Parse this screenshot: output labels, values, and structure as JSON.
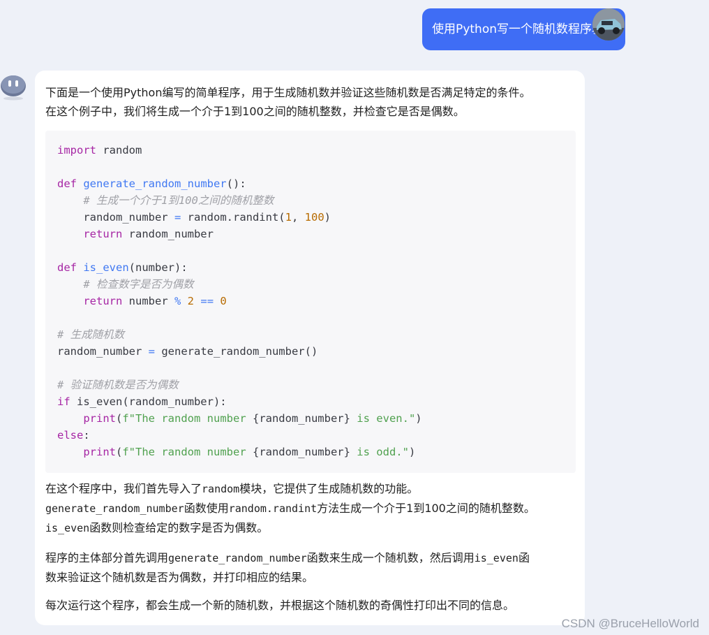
{
  "user_message": "使用Python写一个随机数程序验证",
  "reply": {
    "intro_line1": "下面是一个使用Python编写的简单程序，用于生成随机数并验证这些随机数是否满足特定的条件。",
    "intro_line2": "在这个例子中，我们将生成一个介于1到100之间的随机整数，并检查它是否是偶数。",
    "code": {
      "l1_kw": "import",
      "l1_rest": " random",
      "l3_kw": "def",
      "l3_fn": "generate_random_number",
      "l3_rest": "():",
      "l4_cm": "# 生成一个介于1到100之间的随机整数",
      "l5_a": "random_number ",
      "l5_op": "=",
      "l5_b": " random.randint(",
      "l5_n1": "1",
      "l5_c": ", ",
      "l5_n2": "100",
      "l5_d": ")",
      "l6_kw": "return",
      "l6_rest": " random_number",
      "l8_kw": "def",
      "l8_fn": "is_even",
      "l8_rest": "(number):",
      "l9_cm": "# 检查数字是否为偶数",
      "l10_kw": "return",
      "l10_a": " number ",
      "l10_op1": "%",
      "l10_sp1": " ",
      "l10_n1": "2",
      "l10_sp2": " ",
      "l10_op2": "==",
      "l10_sp3": " ",
      "l10_n2": "0",
      "l12_cm": "# 生成随机数",
      "l13_a": "random_number ",
      "l13_op": "=",
      "l13_b": " generate_random_number()",
      "l15_cm": "# 验证随机数是否为偶数",
      "l16_kw": "if",
      "l16_rest": " is_even(random_number):",
      "l17_kw": "print",
      "l17_a": "(",
      "l17_s1": "f\"The random number ",
      "l17_b": "{random_number}",
      "l17_s2": " is even.\"",
      "l17_c": ")",
      "l18_kw": "else",
      "l18_rest": ":",
      "l19_kw": "print",
      "l19_a": "(",
      "l19_s1": "f\"The random number ",
      "l19_b": "{random_number}",
      "l19_s2": " is odd.\"",
      "l19_c": ")"
    },
    "p2_a": "在这个程序中，我们首先导入了",
    "p2_m1": "random",
    "p2_b": "模块，它提供了生成随机数的功能。",
    "p2_m2": "generate_random_number",
    "p2_c": "函数使用",
    "p2_m3": "random.randint",
    "p2_d": "方法生成一个介于1到100之间的随机整数。",
    "p2_m4": "is_even",
    "p2_e": "函数则检查给定的数字是否为偶数。",
    "p3_a": "程序的主体部分首先调用",
    "p3_m1": "generate_random_number",
    "p3_b": "函数来生成一个随机数，然后调用",
    "p3_m2": "is_even",
    "p3_c": "函",
    "p3_d": "数来验证这个随机数是否为偶数，并打印相应的结果。",
    "p4": "每次运行这个程序，都会生成一个新的随机数，并根据这个随机数的奇偶性打印出不同的信息。"
  },
  "watermark": "CSDN @BruceHelloWorld"
}
